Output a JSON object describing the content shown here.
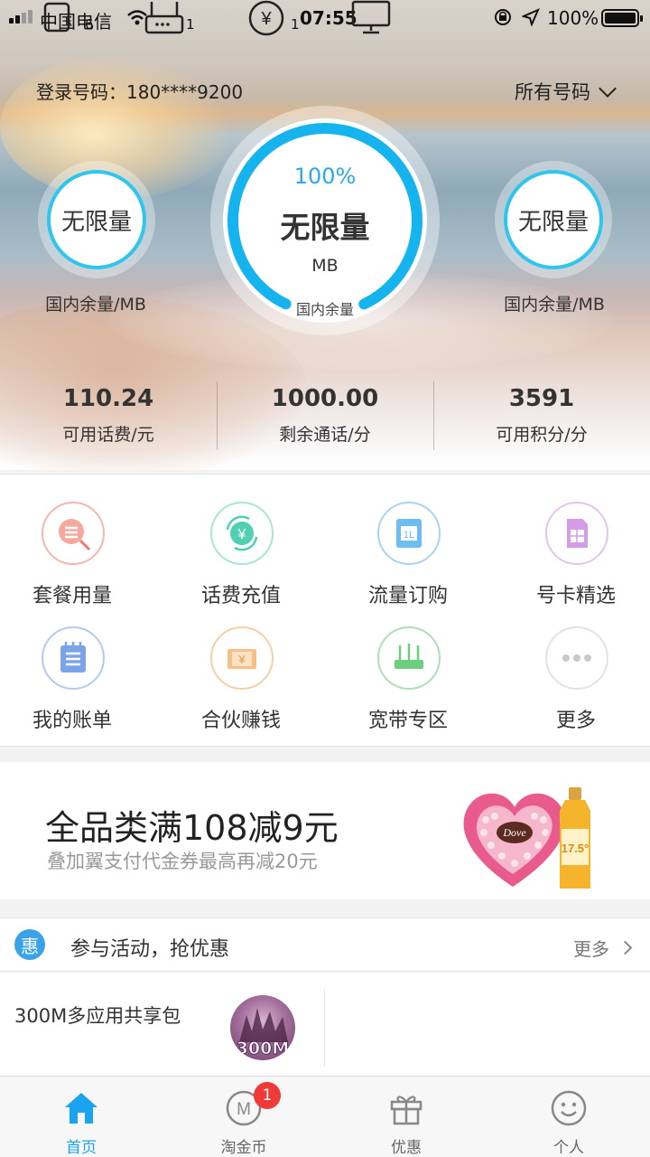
{
  "status_bar": {
    "carrier": "中国电信",
    "overlay_counts": [
      "6",
      "1",
      "1"
    ],
    "time": "07:55",
    "battery": "100%",
    "battery_level": 1.0
  },
  "header": {
    "login_label": "登录号码：180****9200",
    "all_numbers": "所有号码"
  },
  "gauges": {
    "left": {
      "value": "无限量",
      "caption": "国内余量/MB"
    },
    "center": {
      "percent": "100%",
      "value": "无限量",
      "unit": "MB",
      "caption": "国内余量",
      "progress": 0.86
    },
    "right": {
      "value": "无限量",
      "caption": "国内余量/MB"
    }
  },
  "stats": [
    {
      "value": "110.24",
      "label": "可用话费/元"
    },
    {
      "value": "1000.00",
      "label": "剩余通话/分"
    },
    {
      "value": "3591",
      "label": "可用积分/分"
    }
  ],
  "grid": [
    {
      "label": "套餐用量",
      "icon": "package-usage-icon",
      "color": "#f07a6e"
    },
    {
      "label": "话费充值",
      "icon": "recharge-icon",
      "color": "#3cc7a8"
    },
    {
      "label": "流量订购",
      "icon": "data-order-icon",
      "color": "#42a8e6"
    },
    {
      "label": "号卡精选",
      "icon": "sim-card-icon",
      "color": "#c58ad8"
    },
    {
      "label": "我的账单",
      "icon": "bill-icon",
      "color": "#5a8fe0"
    },
    {
      "label": "合伙赚钱",
      "icon": "partner-money-icon",
      "color": "#f0a35a"
    },
    {
      "label": "宽带专区",
      "icon": "broadband-router-icon",
      "color": "#55c56a"
    },
    {
      "label": "更多",
      "icon": "more-dots-icon",
      "color": "#bbbbbb"
    }
  ],
  "banner": {
    "title": "全品类满108减9元",
    "subtitle": "叠加翼支付代金券最高再减20元",
    "heart_brand": "Dove",
    "bottle_label": "17.5°"
  },
  "activity": {
    "badge": "惠",
    "title": "参与活动，抢优惠",
    "more": "更多",
    "card_title": "300M多应用共享包",
    "card_badge": "300M"
  },
  "tabbar": {
    "tabs": [
      {
        "label": "首页",
        "icon": "home-icon",
        "active": true
      },
      {
        "label": "淘金币",
        "icon": "gold-coin-icon",
        "active": false
      },
      {
        "label": "优惠",
        "icon": "gift-icon",
        "active": false
      },
      {
        "label": "个人",
        "icon": "smiley-profile-icon",
        "active": false
      }
    ],
    "coin_badge": "1"
  },
  "colors": {
    "accent": "#1aa3ee",
    "gauge_ring": "#2ec6ee",
    "badge_red": "#f03a3a"
  }
}
